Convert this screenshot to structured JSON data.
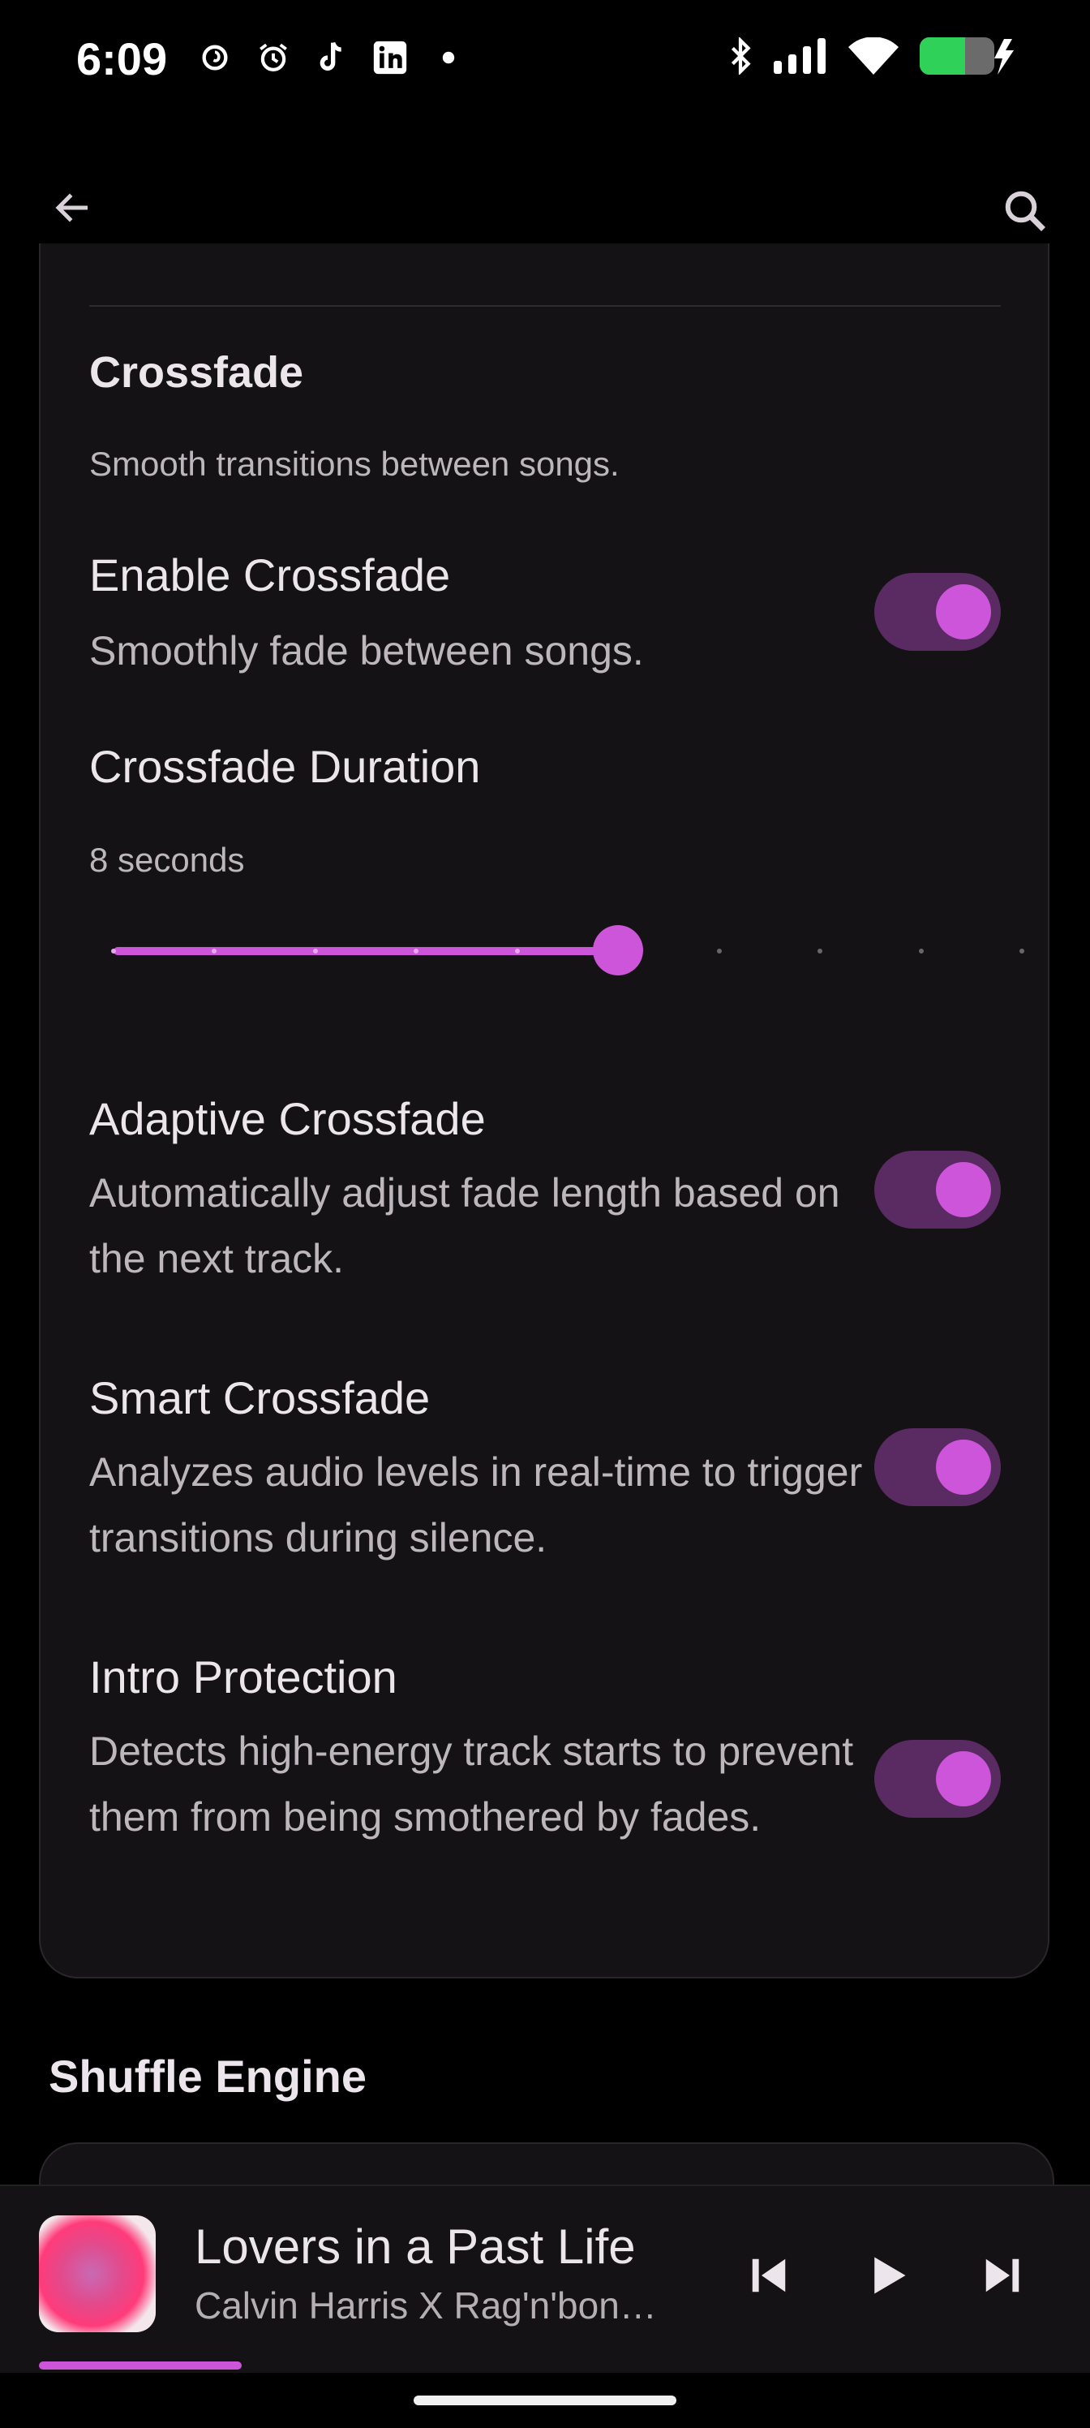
{
  "status_bar": {
    "time": "6:09",
    "left_icons": [
      "threads-icon",
      "alarm-icon",
      "tiktok-icon",
      "linkedin-icon",
      "dot-icon"
    ],
    "right_icons": [
      "bluetooth-icon",
      "signal-icon",
      "wifi-icon",
      "battery-charging-icon"
    ],
    "battery_level": 0.6
  },
  "app_bar": {
    "back_icon": "arrow-back-icon",
    "search_icon": "search-icon"
  },
  "crossfade": {
    "title": "Crossfade",
    "subtitle": "Smooth transitions between songs.",
    "enable": {
      "title": "Enable Crossfade",
      "desc": "Smoothly fade between songs.",
      "on": true
    },
    "duration": {
      "title": "Crossfade Duration",
      "value_label": "8 seconds",
      "value": 6,
      "min": 1,
      "max": 10
    },
    "adaptive": {
      "title": "Adaptive Crossfade",
      "desc": "Automatically adjust fade length based on the next track.",
      "on": true
    },
    "smart": {
      "title": "Smart Crossfade",
      "desc": "Analyzes audio levels in real-time to trigger transitions during silence.",
      "on": true
    },
    "intro": {
      "title": "Intro Protection",
      "desc": "Detects high-energy track starts to prevent them from being smothered by fades.",
      "on": true
    }
  },
  "shuffle_engine": {
    "title": "Shuffle Engine"
  },
  "mini_player": {
    "title": "Lovers in a Past Life",
    "artist": "Calvin Harris X Rag'n'bon…",
    "progress": 0.2
  },
  "colors": {
    "accent": "#cc55d9",
    "toggle_track": "#5a2a63",
    "card": "#141214",
    "background": "#000000"
  }
}
